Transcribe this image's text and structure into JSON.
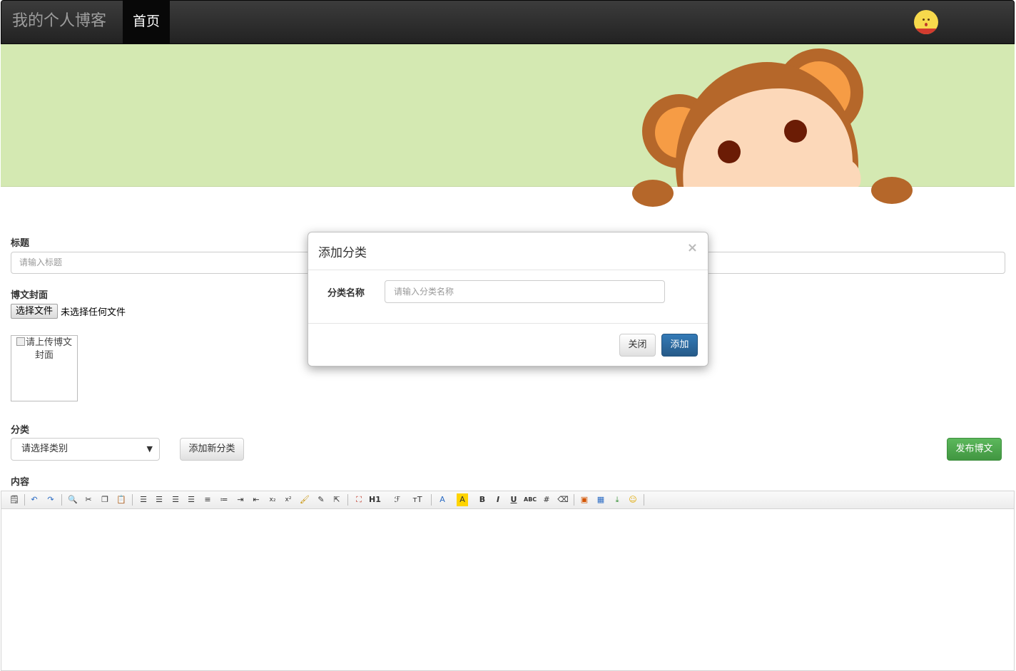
{
  "navbar": {
    "brand": "我的个人博客",
    "home": "首页"
  },
  "form": {
    "title_label": "标题",
    "title_placeholder": "请输入标题",
    "cover_label": "博文封面",
    "file_button": "选择文件",
    "file_status": "未选择任何文件",
    "cover_alt": "请上传博文封面",
    "category_label": "分类",
    "category_select": "请选择类别",
    "add_category_button": "添加新分类",
    "publish_button": "发布博文",
    "content_label": "内容"
  },
  "toolbar": {
    "heading": "H1",
    "font": "ℱ",
    "font_size": "тT",
    "font_color": "A",
    "bg_color": "A",
    "bold": "B",
    "italic": "I",
    "underline": "U",
    "strike": "ABC"
  },
  "modal": {
    "title": "添加分类",
    "close_x": "×",
    "name_label": "分类名称",
    "name_placeholder": "请输入分类名称",
    "close_button": "关闭",
    "add_button": "添加"
  },
  "colors": {
    "banner": "#d4e9b2",
    "primary": "#337ab7",
    "success": "#5cb85c",
    "navbar": "#222222"
  }
}
